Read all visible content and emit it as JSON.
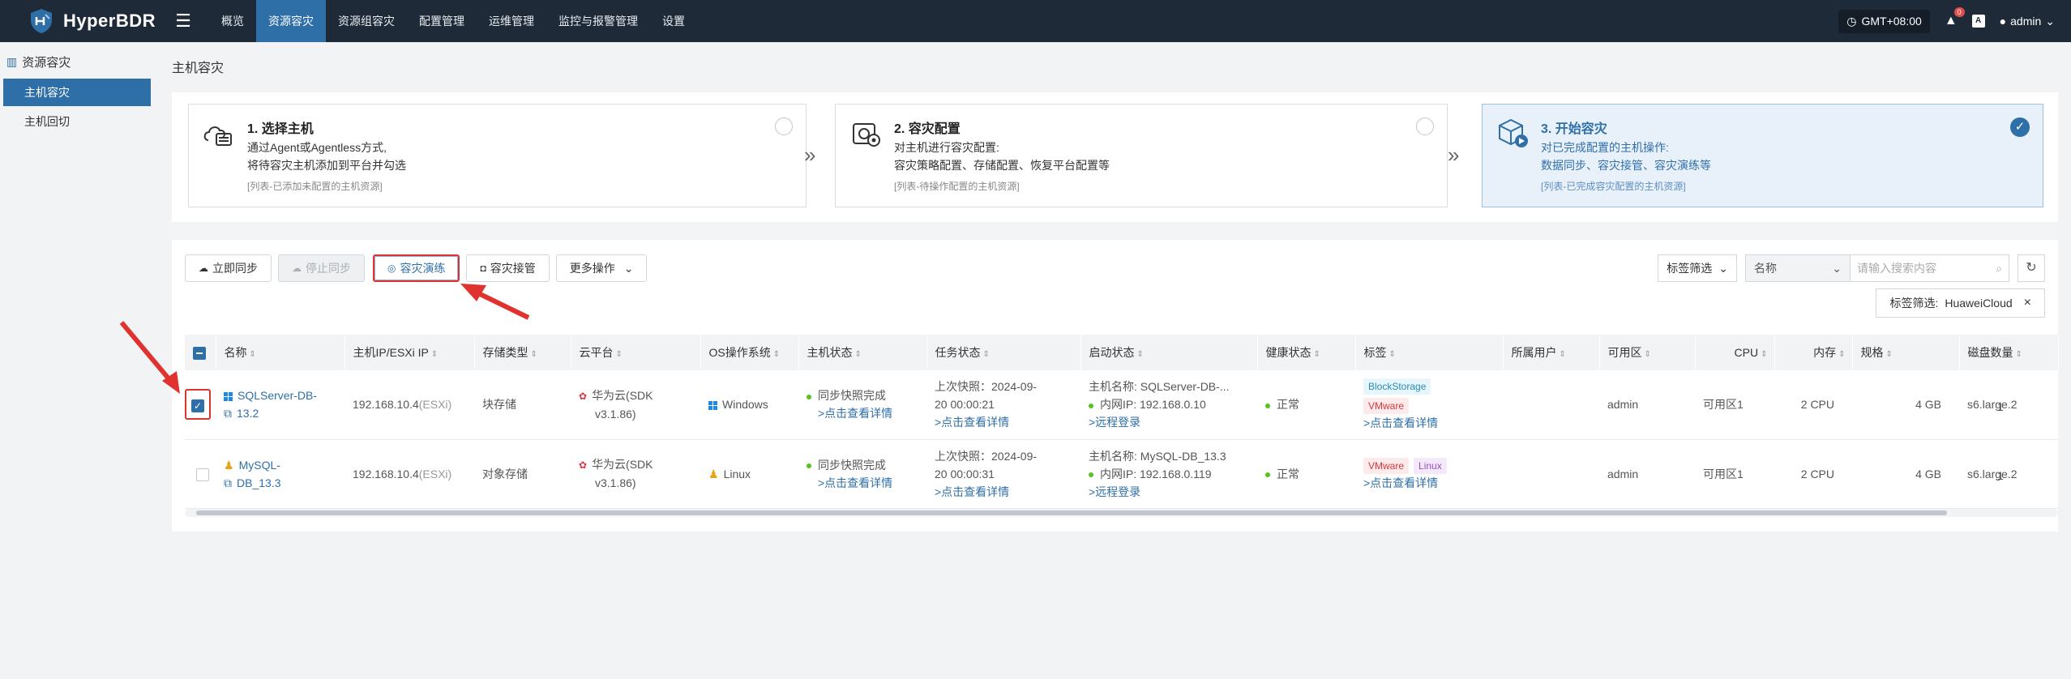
{
  "app": {
    "name": "HyperBDR"
  },
  "nav": [
    "概览",
    "资源容灾",
    "资源组容灾",
    "配置管理",
    "运维管理",
    "监控与报警管理",
    "设置"
  ],
  "topright": {
    "timezone": "GMT+08:00",
    "alert_count": "0",
    "lang": "A",
    "user": "admin"
  },
  "sidebar": {
    "group": "资源容灾",
    "items": [
      "主机容灾",
      "主机回切"
    ]
  },
  "page": {
    "title": "主机容灾"
  },
  "steps": [
    {
      "title": "1. 选择主机",
      "line1": "通过Agent或Agentless方式,",
      "line2": "将待容灾主机添加到平台并勾选",
      "note": "[列表-已添加未配置的主机资源]"
    },
    {
      "title": "2. 容灾配置",
      "line1": "对主机进行容灾配置:",
      "line2": "容灾策略配置、存储配置、恢复平台配置等",
      "note": "[列表-待操作配置的主机资源]"
    },
    {
      "title": "3. 开始容灾",
      "line1": "对已完成配置的主机操作:",
      "line2": "数据同步、容灾接管、容灾演练等",
      "note": "[列表-已完成容灾配置的主机资源]"
    }
  ],
  "toolbar": {
    "sync": "立即同步",
    "stop": "停止同步",
    "drill": "容灾演练",
    "takeover": "容灾接管",
    "more": "更多操作"
  },
  "filters": {
    "tag_filter": "标签筛选",
    "field": "名称",
    "search_placeholder": "请输入搜索内容",
    "active_filter_label": "标签筛选:",
    "active_filter_value": "HuaweiCloud"
  },
  "columns": [
    "名称",
    "主机IP/ESXi IP",
    "存储类型",
    "云平台",
    "OS操作系统",
    "主机状态",
    "任务状态",
    "启动状态",
    "健康状态",
    "标签",
    "所属用户",
    "可用区",
    "CPU",
    "内存",
    "规格",
    "磁盘数量"
  ],
  "rows": [
    {
      "name1": "SQLServer-DB-",
      "name2": "13.2",
      "ip": "192.168.10.4",
      "ip_suffix": "(ESXi)",
      "storage": "块存储",
      "cloud1": "华为云(SDK",
      "cloud2": "v3.1.86)",
      "os": "Windows",
      "host_status": "同步快照完成",
      "host_link": ">点击查看详情",
      "task1": "上次快照：2024-09-",
      "task2": "20 00:00:21",
      "task_link": ">点击查看详情",
      "boot1": "主机名称: SQLServer-DB-...",
      "boot2": "内网IP: 192.168.0.10",
      "boot_link": ">远程登录",
      "health": "正常",
      "tags": [
        "BlockStorage",
        "VMware"
      ],
      "tag_link": ">点击查看详情",
      "user": "admin",
      "zone": "可用区1",
      "cpu": "2 CPU",
      "mem": "4 GB",
      "spec": "s6.large.2",
      "disks": "1"
    },
    {
      "name1": "MySQL-",
      "name2": "DB_13.3",
      "ip": "192.168.10.4",
      "ip_suffix": "(ESXi)",
      "storage": "对象存储",
      "cloud1": "华为云(SDK",
      "cloud2": "v3.1.86)",
      "os": "Linux",
      "host_status": "同步快照完成",
      "host_link": ">点击查看详情",
      "task1": "上次快照：2024-09-",
      "task2": "20 00:00:31",
      "task_link": ">点击查看详情",
      "boot1": "主机名称: MySQL-DB_13.3",
      "boot2": "内网IP: 192.168.0.119",
      "boot_link": ">远程登录",
      "health": "正常",
      "tags": [
        "VMware",
        "Linux"
      ],
      "tag_link": ">点击查看详情",
      "user": "admin",
      "zone": "可用区1",
      "cpu": "2 CPU",
      "mem": "4 GB",
      "spec": "s6.large.2",
      "disks": "1"
    }
  ],
  "colors": {
    "topbar": "#1f2a38",
    "accent": "#2f6fa8",
    "highlight": "#e0332f"
  }
}
